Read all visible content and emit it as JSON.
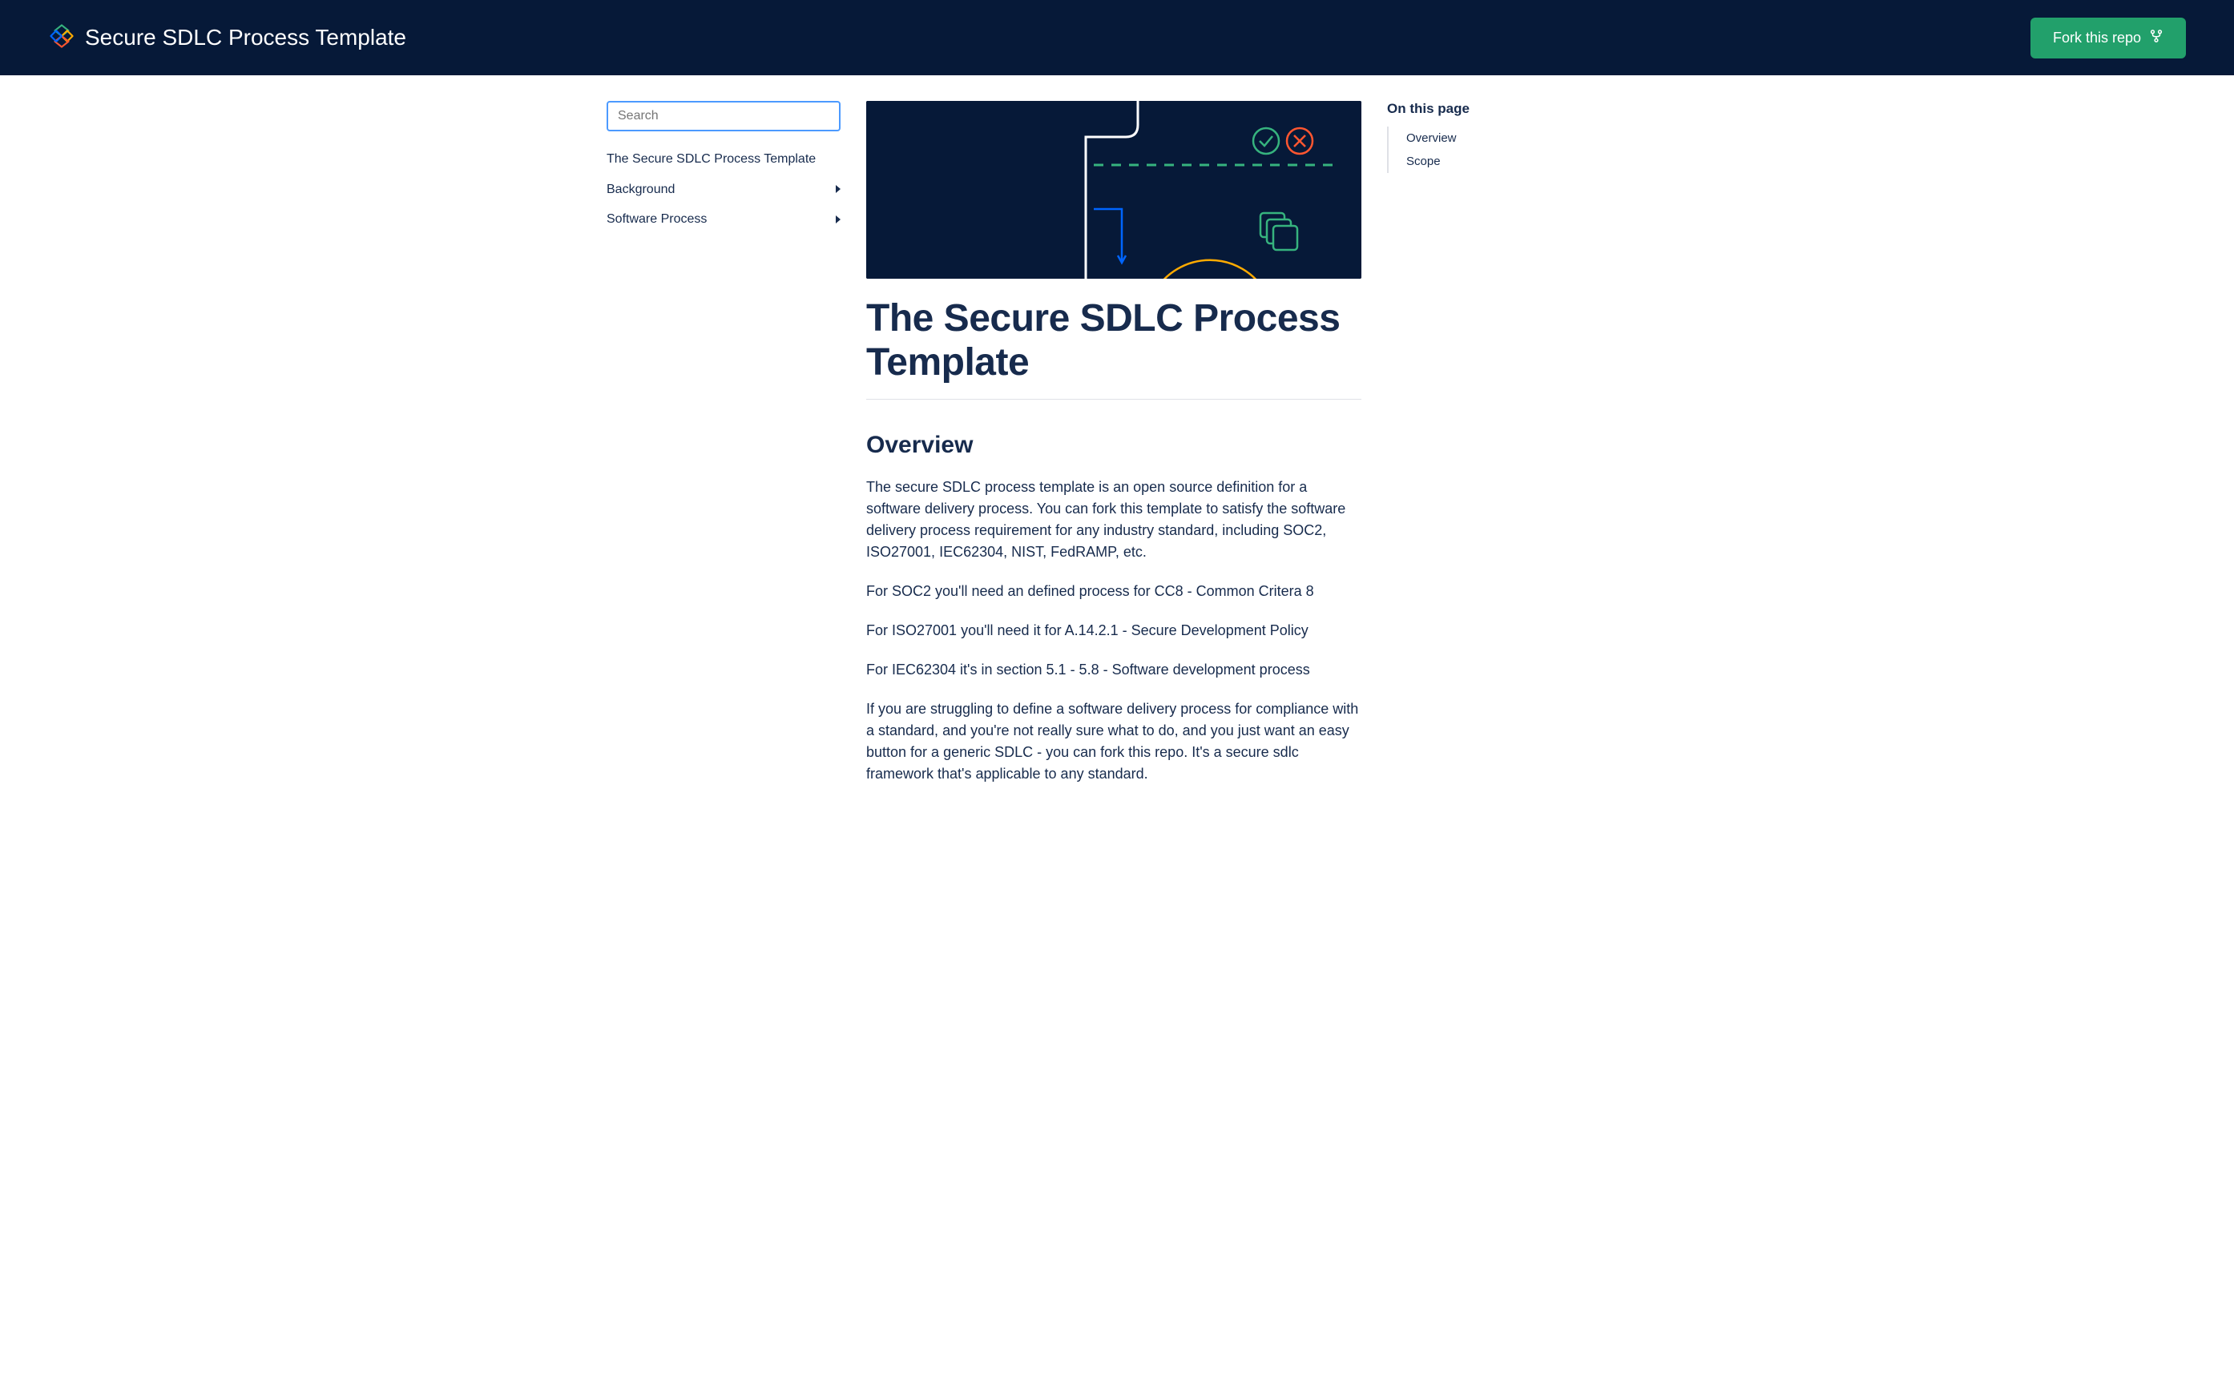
{
  "header": {
    "title": "Secure SDLC Process Template",
    "fork_label": "Fork this repo"
  },
  "sidebar": {
    "search_placeholder": "Search",
    "items": [
      {
        "label": "The Secure SDLC Process Template",
        "expandable": false
      },
      {
        "label": "Background",
        "expandable": true
      },
      {
        "label": "Software Process",
        "expandable": true
      }
    ]
  },
  "main": {
    "title": "The Secure SDLC Process Template",
    "overview_heading": "Overview",
    "paragraphs": [
      "The secure SDLC process template is an open source definition for a software delivery process. You can fork this template to satisfy the software delivery process requirement for any industry standard, including SOC2, ISO27001, IEC62304, NIST, FedRAMP, etc.",
      "For SOC2 you'll need an defined process for CC8 - Common Critera 8",
      "For ISO27001 you'll need it for A.14.2.1 - Secure Development Policy",
      "For IEC62304 it's in section 5.1 - 5.8 - Software development process",
      "If you are struggling to define a software delivery process for compliance with a standard, and you're not really sure what to do, and you just want an easy button for a generic SDLC - you can fork this repo. It's a secure sdlc framework that's applicable to any standard."
    ]
  },
  "otp": {
    "title": "On this page",
    "items": [
      {
        "label": "Overview"
      },
      {
        "label": "Scope"
      }
    ]
  }
}
